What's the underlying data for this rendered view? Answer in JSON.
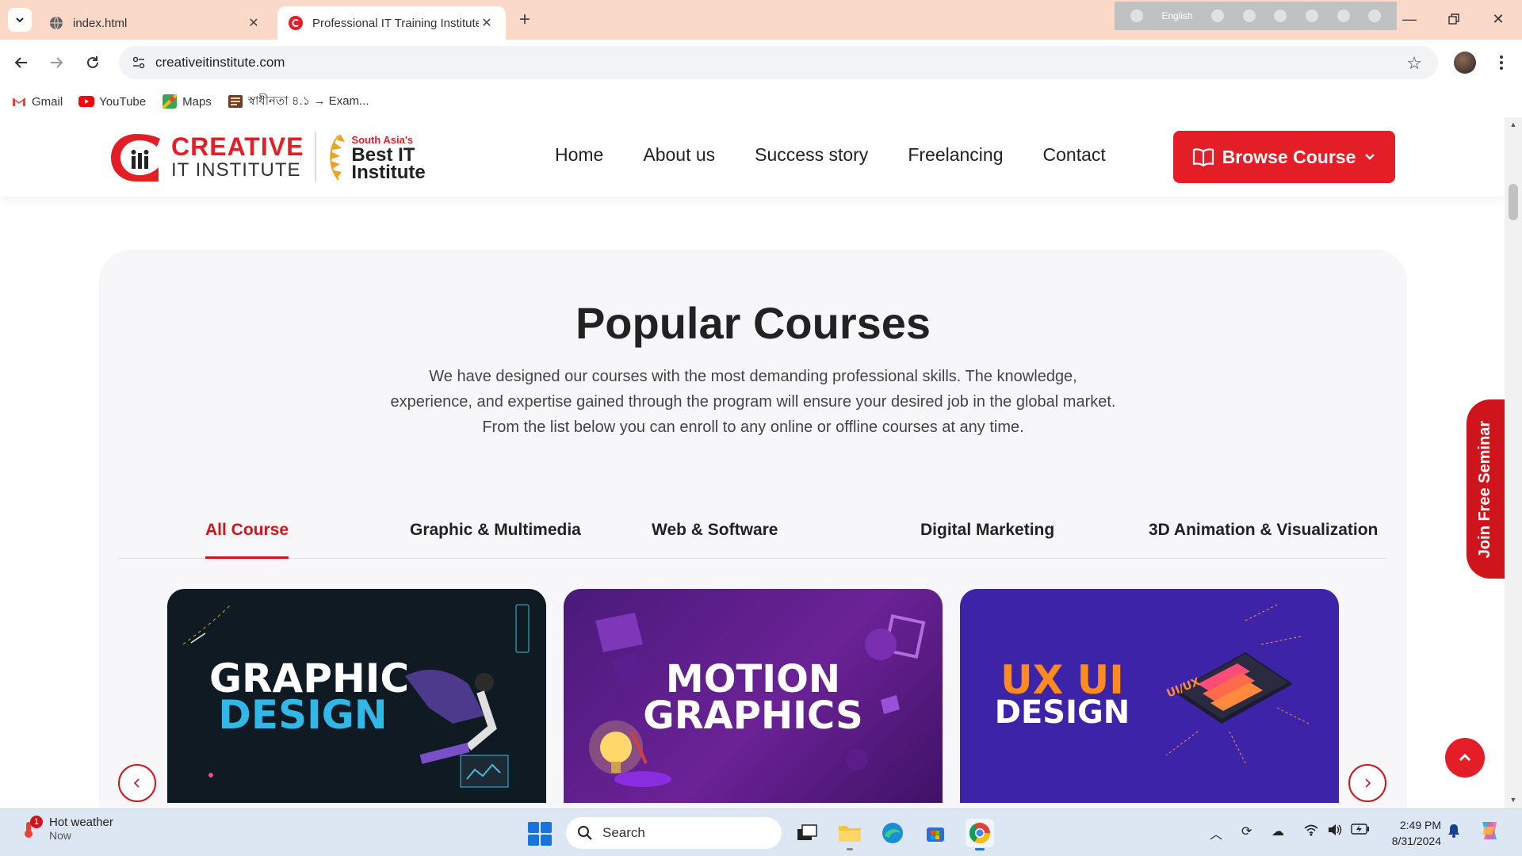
{
  "browser": {
    "tabs": [
      {
        "title": "index.html",
        "active": false
      },
      {
        "title": "Professional IT Training Institute",
        "active": true
      }
    ],
    "extension_language": "English",
    "url": "creativeitinstitute.com",
    "bookmarks": [
      "Gmail",
      "YouTube",
      "Maps",
      "স্বাধীনতা ৪.১ → Exam..."
    ]
  },
  "site": {
    "brand_line1": "CREATIVE",
    "brand_line2": "IT INSTITUTE",
    "award_line1": "South Asia's",
    "award_line2": "Best IT",
    "award_line3": "Institute",
    "nav": [
      "Home",
      "About us",
      "Success story",
      "Freelancing",
      "Contact"
    ],
    "browse_label": "Browse Course",
    "seminar_label": "Join Free Seminar",
    "colors": {
      "brand_red": "#e41e26",
      "accent_red": "#d0141c"
    }
  },
  "courses": {
    "title": "Popular Courses",
    "desc_lines": [
      "We have designed our courses with the most demanding professional skills. The knowledge,",
      "experience, and expertise gained through the program will ensure your desired job in the global market.",
      "From the list below you can enroll to any online or offline courses at any time."
    ],
    "tabs": [
      "All Course",
      "Graphic & Multimedia",
      "Web & Software",
      "Digital Marketing",
      "3D Animation & Visualization"
    ],
    "active_tab": "All Course",
    "cards": [
      {
        "line1": "GRAPHIC",
        "line2": "DESIGN"
      },
      {
        "line1": "MOTION",
        "line2": "GRAPHICS"
      },
      {
        "line1": "UX UI",
        "line2": "DESIGN",
        "tag": "UI/UX"
      }
    ]
  },
  "taskbar": {
    "weather_title": "Hot weather",
    "weather_sub": "Now",
    "weather_badge": "1",
    "search_placeholder": "Search",
    "time": "2:49 PM",
    "date": "8/31/2024"
  }
}
